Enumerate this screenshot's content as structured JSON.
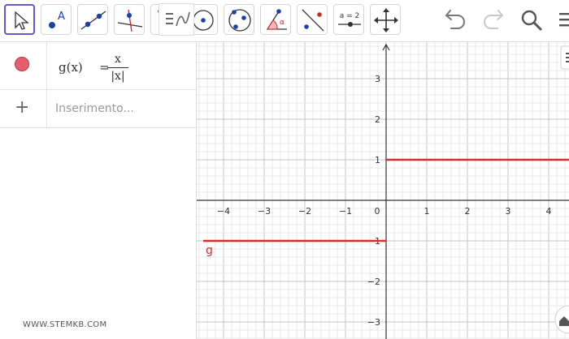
{
  "toolbar": {
    "tools": [
      {
        "name": "move-tool",
        "icon": "cursor-arrow-icon"
      },
      {
        "name": "point-tool",
        "icon": "point-A-icon",
        "label": "A"
      },
      {
        "name": "line-tool",
        "icon": "line-through-points-icon"
      },
      {
        "name": "perpendicular-line-tool",
        "icon": "perpendicular-line-icon"
      },
      {
        "name": "polygon-tool",
        "icon": "polygon-icon"
      },
      {
        "name": "circle-center-point-tool",
        "icon": "circle-center-icon"
      },
      {
        "name": "circle-three-points-tool",
        "icon": "circle-three-points-icon"
      },
      {
        "name": "angle-tool",
        "icon": "angle-icon",
        "label": "α"
      },
      {
        "name": "reflect-tool",
        "icon": "reflect-about-line-icon"
      },
      {
        "name": "slider-tool",
        "icon": "slider-icon",
        "label": "a = 2"
      },
      {
        "name": "move-graphics-view-tool",
        "icon": "move-arrows-icon"
      }
    ],
    "actions": [
      {
        "name": "undo-button",
        "icon": "undo-icon"
      },
      {
        "name": "redo-button",
        "icon": "redo-icon"
      },
      {
        "name": "search-button",
        "icon": "search-icon"
      },
      {
        "name": "menu-button",
        "icon": "menu-icon"
      }
    ]
  },
  "algebra": {
    "rows": [
      {
        "lhs": "g(x)",
        "eq": "=",
        "numerator": "x",
        "denominator": "|x|",
        "color": "#e6606b"
      }
    ],
    "input": {
      "placeholder": "Inserimento..."
    },
    "watermark": "WWW.STEMKB.COM"
  },
  "graphics": {
    "function_label": "g",
    "function_color": "#d32f2f",
    "x_ticks": [
      "−4",
      "−3",
      "−2",
      "−1",
      "0",
      "1",
      "2",
      "3",
      "4"
    ],
    "y_ticks": [
      "3",
      "2",
      "1",
      "−1",
      "−2",
      "−3"
    ],
    "x_range": [
      -4.5,
      4.5
    ],
    "y_range": [
      -3.3,
      3.9
    ],
    "segments": [
      {
        "x_from": -4.5,
        "x_to": 0,
        "y": -1
      },
      {
        "x_from": 0,
        "x_to": 4.5,
        "y": 1
      }
    ]
  }
}
